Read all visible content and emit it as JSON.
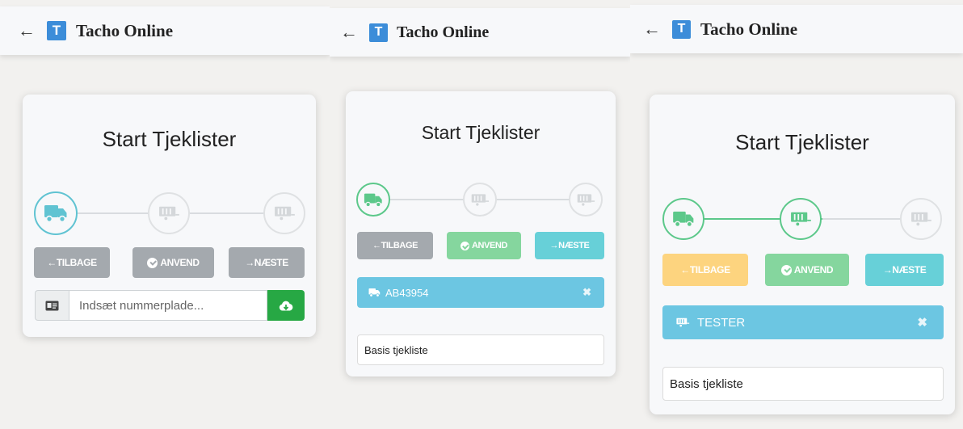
{
  "app": {
    "title": "Tacho Online",
    "logo_letter": "T"
  },
  "card": {
    "title": "Start Tjeklister"
  },
  "buttons": {
    "back": "TILBAGE",
    "apply": "ANVEND",
    "next": "NÆSTE",
    "arrow": "←",
    "arrow_right": "→"
  },
  "panels": [
    {
      "plate_input": {
        "placeholder": "Indsæt nummerplade..."
      }
    },
    {
      "vehicle": {
        "name": "AB43954",
        "close": "✖"
      },
      "checklist": {
        "name": "Basis tjekliste"
      }
    },
    {
      "vehicle": {
        "name": "TESTER",
        "close": "✖"
      },
      "checklist": {
        "name": "Basis tjekliste"
      }
    }
  ],
  "colors": {
    "brand": "#3c8dd9",
    "grey_button": "#a4a9ae",
    "warning": "#fdd47f",
    "success_light": "#85d69e",
    "info": "#67d0d8",
    "vehicle_bar": "#6cc6e2",
    "upload_green": "#27a844",
    "step_active_teal": "#60c3d2",
    "step_done_green": "#5cc88a"
  },
  "icons": [
    "back-arrow-icon",
    "truck-icon",
    "trailer-icon",
    "id-card-icon",
    "cloud-upload-icon",
    "check-circle-icon",
    "close-icon"
  ]
}
